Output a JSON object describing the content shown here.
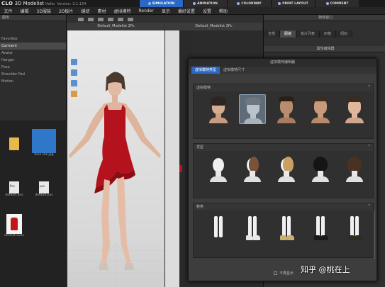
{
  "app": {
    "logo_text": "3D Modelist",
    "logo_sub": "Hello.",
    "version_label": "Version: 2.1.134",
    "mode_tabs": [
      {
        "label": "SIMULATION",
        "active": true
      },
      {
        "label": "ANIMATION",
        "active": false
      },
      {
        "label": "COLORWAY",
        "active": false
      },
      {
        "label": "PRINT LAYOUT",
        "active": false
      },
      {
        "label": "COMMENT",
        "active": false
      }
    ]
  },
  "menubar": {
    "items": [
      "文件",
      "编辑",
      "3D服装",
      "2D板片",
      "缝纫",
      "素材",
      "虚拟模特",
      "Render",
      "显示",
      "偏好设置",
      "设置",
      "帮助"
    ]
  },
  "left_panel": {
    "header": "图库",
    "tree": [
      {
        "label": "Favorites",
        "selected": false
      },
      {
        "label": "Garment",
        "selected": true
      },
      {
        "label": "Avatar",
        "selected": false
      },
      {
        "label": "Hanger",
        "selected": false
      },
      {
        "label": "Pose",
        "selected": false
      },
      {
        "label": "Shoulder Pad",
        "selected": false
      },
      {
        "label": "Motion",
        "selected": false
      }
    ],
    "files": [
      {
        "label": "..",
        "kind": "folder"
      },
      {
        "label": "blue silk.jpg",
        "kind": "image"
      },
      {
        "label": "default.pos",
        "kind": "doc",
        "ext": "Pos"
      },
      {
        "label": "default.pos",
        "kind": "doc",
        "ext": "pos"
      },
      {
        "label": "default.avac",
        "kind": "dress"
      }
    ]
  },
  "viewport_3d": {
    "header": "Default_Modelist 2Pc"
  },
  "viewport_2d": {
    "header": "Default_Modelist 2Pc"
  },
  "right_panel": {
    "header": "物体窗口",
    "tabs": [
      {
        "label": "全部",
        "active": false
      },
      {
        "label": "服装",
        "active": true
      },
      {
        "label": "板片列表",
        "active": false
      },
      {
        "label": "织物",
        "active": false
      },
      {
        "label": "纽扣",
        "active": false
      }
    ],
    "sub_header": "属性编辑器"
  },
  "modal": {
    "title": "虚拟模特编辑器",
    "tabs": [
      {
        "label": "虚拟模特类型",
        "active": true
      },
      {
        "label": "虚拟模特尺寸",
        "active": false
      }
    ],
    "sections": [
      {
        "title": "虚拟模特",
        "kind": "face",
        "count": 5
      },
      {
        "title": "发型",
        "kind": "hair",
        "count": 5
      },
      {
        "title": "鞋类",
        "kind": "shoes",
        "count": 5
      }
    ],
    "footer_checkbox": "不再显示"
  },
  "watermark": "知乎 @桃在上",
  "colors": {
    "accent": "#2b67c4",
    "dress": "#c01818",
    "folder": "#e6b94a"
  }
}
